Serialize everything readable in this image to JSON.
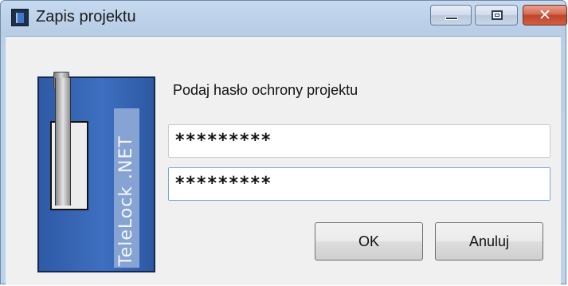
{
  "window": {
    "title": "Zapis projektu",
    "app_icon": "app-icon",
    "controls": {
      "minimize": "minimize-icon",
      "maximize": "maximize-icon",
      "close": "close-icon",
      "close_glyph": "✕"
    }
  },
  "graphic": {
    "label": "TeleLock .NET",
    "icon": "padlock-icon"
  },
  "form": {
    "prompt": "Podaj hasło ochrony projektu",
    "password1": "*********",
    "password2": "*********"
  },
  "buttons": {
    "ok_label": "OK",
    "cancel_label": "Anuluj"
  },
  "colors": {
    "close_accent": "#c0442c",
    "lock_blue": "#3e6fc0",
    "focus_border": "#7aa7d9"
  }
}
